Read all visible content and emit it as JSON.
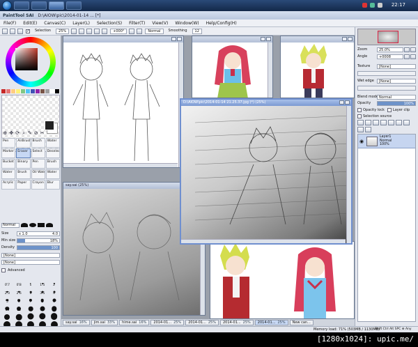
{
  "taskbar": {
    "clock": "22:17"
  },
  "app": {
    "logo": "PaintTool SAI",
    "title": "D:\\AIOW\\pic\\2014-01-14 ... [*]"
  },
  "menu": [
    "File(F)",
    "Edit(E)",
    "Canvas(C)",
    "Layer(L)",
    "Selection(S)",
    "Filter(T)",
    "View(V)",
    "Window(W)",
    "Help/Config(H)"
  ],
  "toolbar": {
    "selection_label": "Selection",
    "zoom": "25%",
    "rotation": "+000°",
    "mode": "Normal",
    "smoothing_label": "Smoothing",
    "smoothing": "12"
  },
  "colors": {
    "swatches": [
      "#c62828",
      "#e57373",
      "#ffcc80",
      "#fff176",
      "#81c784",
      "#4fc3f7",
      "#3f51b5",
      "#8e24aa",
      "#795548",
      "#9e9e9e",
      "#ffffff",
      "#000000"
    ]
  },
  "tools": {
    "icons": [
      "⊕",
      "✥",
      "⟳",
      "⌕",
      "✎",
      "⊘",
      "✂"
    ],
    "brushes": [
      {
        "label": "Pen",
        "selected": false
      },
      {
        "label": "AirBrush",
        "selected": false
      },
      {
        "label": "Brush",
        "selected": false
      },
      {
        "label": "Water",
        "selected": false
      },
      {
        "label": "Marker",
        "selected": false
      },
      {
        "label": "Eraser",
        "selected": true
      },
      {
        "label": "Select",
        "selected": false
      },
      {
        "label": "Deselect",
        "selected": false
      },
      {
        "label": "Bucket",
        "selected": false
      },
      {
        "label": "Binary",
        "selected": false
      },
      {
        "label": "Pen",
        "selected": false
      },
      {
        "label": "Brush",
        "selected": false
      },
      {
        "label": "Water",
        "selected": false
      },
      {
        "label": "Brush",
        "selected": false
      },
      {
        "label": "Oil Wate",
        "selected": false
      },
      {
        "label": "Water",
        "selected": false
      },
      {
        "label": "Acrylic",
        "selected": false
      },
      {
        "label": "Paper",
        "selected": false
      },
      {
        "label": "Crayon",
        "selected": false
      },
      {
        "label": "Blur",
        "selected": false
      }
    ]
  },
  "brush_props": {
    "mode": "Normal",
    "size_label": "Size",
    "size_mult": "x 1.0",
    "size_value": "4.0",
    "min_size_label": "Min size",
    "min_size_value": "18%",
    "min_size_fraction": 0.18,
    "density_label": "Density",
    "density_value": "100",
    "density_fraction": 1.0,
    "texture1": "[None]",
    "texture2": "[None]",
    "advanced_label": "Advanced"
  },
  "brush_sizes": [
    {
      "label": "0.7",
      "d": 1
    },
    {
      "label": "0.8",
      "d": 1
    },
    {
      "label": "1",
      "d": 1.5
    },
    {
      "label": "1.5",
      "d": 1.8
    },
    {
      "label": "2",
      "d": 2
    },
    {
      "label": "2.3",
      "d": 2.2
    },
    {
      "label": "2.6",
      "d": 2.4
    },
    {
      "label": "3",
      "d": 2.6
    },
    {
      "label": "3.5",
      "d": 2.8
    },
    {
      "label": "4",
      "d": 3
    },
    {
      "label": "5",
      "d": 3.4
    },
    {
      "label": "6",
      "d": 3.8
    },
    {
      "label": "7",
      "d": 4.2
    },
    {
      "label": "8",
      "d": 4.6
    },
    {
      "label": "9",
      "d": 5
    },
    {
      "label": "10",
      "d": 5.4
    },
    {
      "label": "12",
      "d": 6
    },
    {
      "label": "14",
      "d": 6.6
    },
    {
      "label": "16",
      "d": 7
    },
    {
      "label": "20",
      "d": 7.5
    },
    {
      "label": "25",
      "d": 8
    },
    {
      "label": "30",
      "d": 8.5
    },
    {
      "label": "35",
      "d": 9
    },
    {
      "label": "40",
      "d": 9.4
    },
    {
      "label": "50",
      "d": 9.8
    },
    {
      "label": "60",
      "d": 10
    },
    {
      "label": "70",
      "d": 10
    },
    {
      "label": "80",
      "d": 10
    },
    {
      "label": "100",
      "d": 10
    },
    {
      "label": "120",
      "d": 10
    },
    {
      "label": "160",
      "d": 10
    },
    {
      "label": "200",
      "d": 10
    },
    {
      "label": "250",
      "d": 10
    },
    {
      "label": "300",
      "d": 10
    },
    {
      "label": "350",
      "d": 10
    },
    {
      "label": "400",
      "d": 10
    },
    {
      "label": "450",
      "d": 10
    },
    {
      "label": "500",
      "d": 10
    }
  ],
  "right_panel": {
    "zoom_label": "Zoom",
    "zoom_value": "25.0%",
    "angle_label": "Angle",
    "angle_value": "+0008",
    "texture_label": "Texture",
    "texture_value": "[None]",
    "wet_edge_label": "Wet edge",
    "wet_edge_value": "[None]",
    "blend_mode_label": "Blend mode",
    "blend_mode_value": "Normal",
    "opacity_label": "Opacity",
    "opacity_value": "100%",
    "opacity_lock": "Opacity lock",
    "layer_clip": "Layer clip",
    "selection_source": "Selection source"
  },
  "layer": {
    "name": "Layer1",
    "mode": "Normal",
    "opacity": "100%"
  },
  "windows": [
    {
      "title": "",
      "active": false
    },
    {
      "title": "",
      "active": false
    },
    {
      "title": "",
      "active": false
    },
    {
      "title": "D:\\AIOW\\pic\\2014-01-14 21.25.37.jpg (*) (25%)",
      "active": true
    },
    {
      "title": "say.sai (25%)",
      "active": false
    },
    {
      "title": "",
      "active": false
    }
  ],
  "tabs": [
    {
      "name": "say.sai",
      "zoom": "16%",
      "active": false
    },
    {
      "name": "jim.sai",
      "zoom": "33%",
      "active": false
    },
    {
      "name": "hime.sai",
      "zoom": "16%",
      "active": false
    },
    {
      "name": "2014-01...",
      "zoom": "25%",
      "active": false
    },
    {
      "name": "2014-01...",
      "zoom": "25%",
      "active": false
    },
    {
      "name": "2014-01...",
      "zoom": "25%",
      "active": false
    },
    {
      "name": "2014-01...",
      "zoom": "25%",
      "active": true
    },
    {
      "name": "New can...",
      "zoom": "",
      "active": false
    }
  ],
  "status": {
    "memory": "Memory load: 71% (503MB / 1130MB)",
    "keys": "Shift Ctrl Alt SPC ⊕ Any"
  },
  "watermark": "[1280x1024]: upic.me/"
}
